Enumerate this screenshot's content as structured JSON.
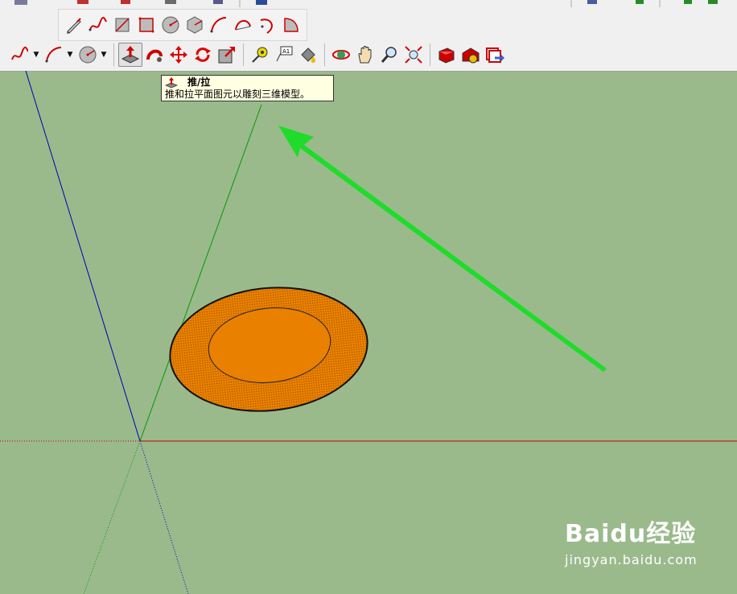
{
  "tooltip": {
    "title": "推/拉",
    "description": "推和拉平面图元以雕刻三维模型。"
  },
  "toolbar_row1": [
    "pencil-icon",
    "freehand-icon",
    "rectangle-icon",
    "rotated-rectangle-icon",
    "circle-icon",
    "polygon-icon",
    "arc-icon",
    "two-point-arc-icon",
    "three-point-arc-icon",
    "pie-icon"
  ],
  "toolbar_row2": [
    "freehand-icon",
    "arc-icon",
    "circle-icon",
    "push-pull-icon",
    "follow-me-icon",
    "move-icon",
    "rotate-icon",
    "scale-icon",
    "tape-measure-icon",
    "text-icon",
    "paint-bucket-icon",
    "orbit-icon",
    "pan-icon",
    "zoom-icon",
    "zoom-extents-icon",
    "components-icon",
    "warehouse-icon",
    "extension-icon"
  ],
  "active_tool": "push-pull-icon",
  "colors": {
    "canvas": "#9aba8c",
    "face": "#ea8000",
    "axis_red": "#c00000",
    "axis_green": "#00a000",
    "axis_blue": "#0000c0",
    "arrow": "#22dd22",
    "tooltip_bg": "#ffffe1"
  },
  "watermark": {
    "logo": "Baidu经验",
    "url": "jingyan.baidu.com"
  }
}
